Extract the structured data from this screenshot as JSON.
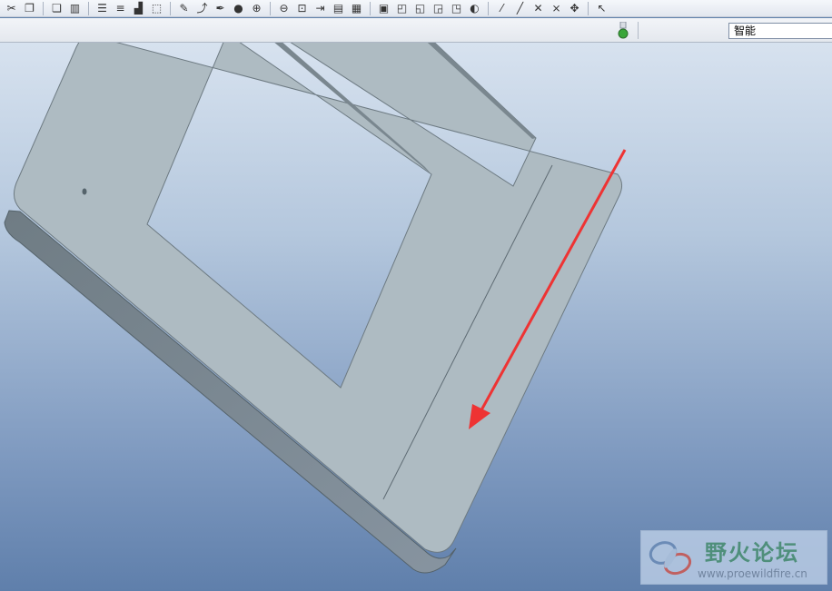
{
  "toolbar": {
    "buttons": [
      {
        "name": "cut-icon",
        "glyph": "✂"
      },
      {
        "name": "copy-icon",
        "glyph": "❐"
      },
      {
        "name": "paste-icon",
        "glyph": "❏"
      },
      {
        "name": "model-tree-icon",
        "glyph": "▥"
      },
      {
        "name": "layer-icon",
        "glyph": "☰"
      },
      {
        "name": "layer-color-icon",
        "glyph": "≡"
      },
      {
        "name": "regenerate-icon",
        "glyph": "▟"
      },
      {
        "name": "select-box-icon",
        "glyph": "⬚"
      },
      {
        "name": "sketch-icon",
        "glyph": "✎"
      },
      {
        "name": "curve-icon",
        "glyph": "⤴"
      },
      {
        "name": "appearance-icon",
        "glyph": "✒"
      },
      {
        "name": "sphere-icon",
        "glyph": "●"
      },
      {
        "name": "zoom-in-icon",
        "glyph": "⊕"
      },
      {
        "name": "zoom-out-icon",
        "glyph": "⊖"
      },
      {
        "name": "zoom-fit-icon",
        "glyph": "⊡"
      },
      {
        "name": "reorient-icon",
        "glyph": "⇥"
      },
      {
        "name": "saved-view-icon",
        "glyph": "▤"
      },
      {
        "name": "view-layers-icon",
        "glyph": "▦"
      },
      {
        "name": "camera-icon",
        "glyph": "▣"
      },
      {
        "name": "wireframe-icon",
        "glyph": "◰"
      },
      {
        "name": "hidden-line-icon",
        "glyph": "◱"
      },
      {
        "name": "no-hidden-icon",
        "glyph": "◲"
      },
      {
        "name": "shading-icon",
        "glyph": "◳"
      },
      {
        "name": "enhanced-shading-icon",
        "glyph": "◐"
      },
      {
        "name": "datum-plane-icon",
        "glyph": "⁄"
      },
      {
        "name": "datum-axis-icon",
        "glyph": "╱"
      },
      {
        "name": "datum-point-icon",
        "glyph": "✕"
      },
      {
        "name": "coord-sys-icon",
        "glyph": "⨯"
      },
      {
        "name": "spin-center-icon",
        "glyph": "✥"
      },
      {
        "name": "select-cursor-icon",
        "glyph": "↖"
      }
    ]
  },
  "status": {
    "filter_value": "智能",
    "traffic_light_color": "#3aa63a"
  },
  "watermark": {
    "title": "野火论坛",
    "url": "www.proewildfire.cn"
  },
  "colors": {
    "part_top": "#aebbc2",
    "part_side": "#7a878f",
    "part_edge": "#54626a",
    "arrow": "#ee3333"
  }
}
